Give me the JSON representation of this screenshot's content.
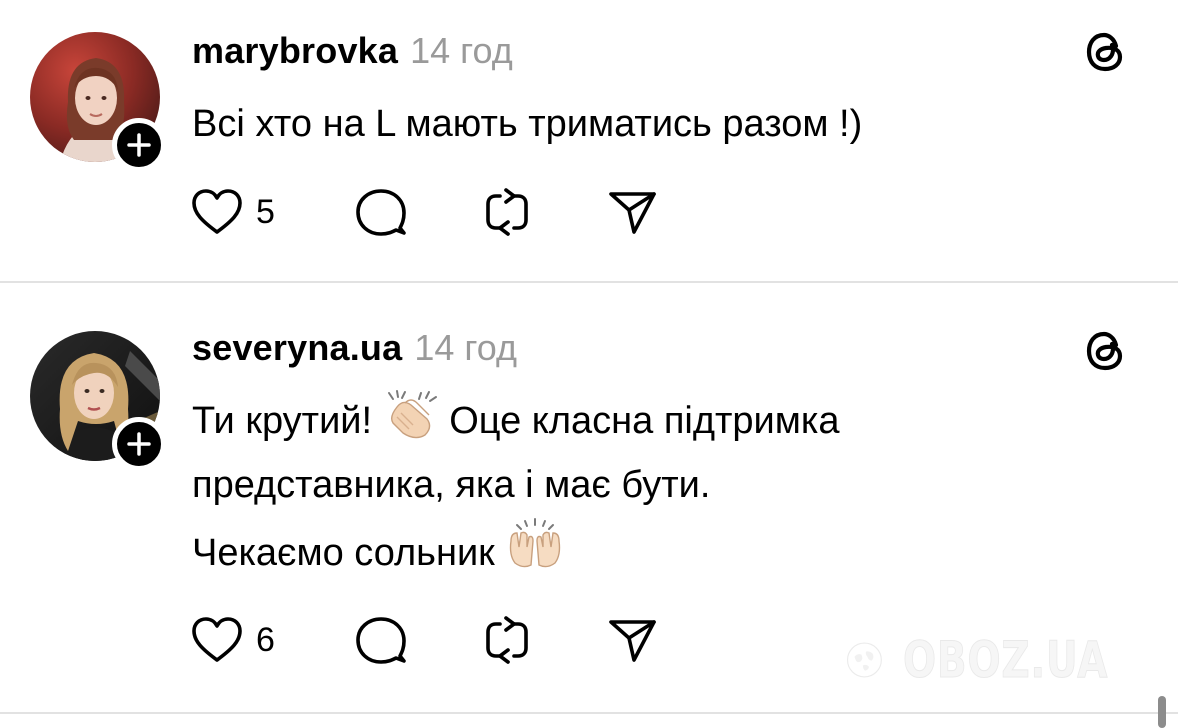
{
  "posts": [
    {
      "username": "marybrovka",
      "time": "14 год",
      "text_lines": [
        "Всі хто на L мають триматись разом !)"
      ],
      "likes": "5",
      "avatar_icon": "avatar-photo",
      "follow_icon": "plus-icon"
    },
    {
      "username": "severyna.ua",
      "time": "14 год",
      "text_lines": [
        "Ти крутий!",
        "Оце класна підтримка",
        "представника, яка і має бути.",
        "Чекаємо сольник"
      ],
      "emoji": [
        "clapping-hands-emoji",
        "raising-hands-emoji"
      ],
      "likes": "6",
      "avatar_icon": "avatar-photo",
      "follow_icon": "plus-icon"
    }
  ],
  "icons": {
    "like": "heart-icon",
    "comment": "comment-bubble-icon",
    "repost": "repost-icon",
    "share": "send-icon",
    "app": "threads-logo-icon"
  },
  "watermark": {
    "text": "OBOZ.UA"
  },
  "colors": {
    "text": "#000000",
    "muted": "#9a9a9a",
    "divider": "#e2e2e2"
  }
}
